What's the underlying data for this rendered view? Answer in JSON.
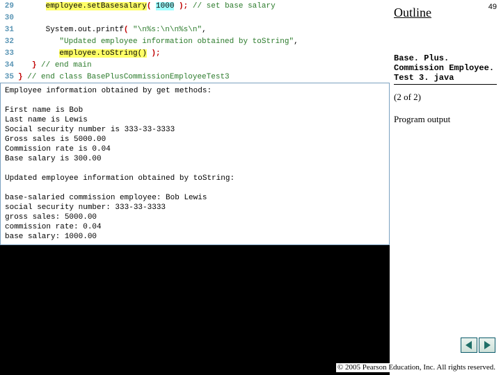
{
  "page_number": "49",
  "outline": {
    "title": "Outline",
    "file_label": "Base. Plus. Commission Employee. Test 3. java",
    "part": "(2 of 2)",
    "section": "Program output"
  },
  "code": {
    "lines": [
      {
        "n": "29",
        "indent": "      ",
        "segments": [
          {
            "t": "employee.set",
            "cls": "hl-yellow"
          },
          {
            "t": "Basesalary",
            "cls": "hl-yellow"
          },
          {
            "t": "( ",
            "cls": "paren"
          },
          {
            "t": "1000",
            "cls": "hl-cyan"
          },
          {
            "t": " )",
            "cls": "paren"
          },
          {
            "t": "; ",
            "cls": "semi"
          },
          {
            "t": "// set base salary",
            "cls": "cmt"
          }
        ]
      },
      {
        "n": "30",
        "indent": "",
        "segments": []
      },
      {
        "n": "31",
        "indent": "      ",
        "segments": [
          {
            "t": "System.out.printf",
            "cls": "kw"
          },
          {
            "t": "( ",
            "cls": "paren"
          },
          {
            "t": "\"\\n%s:\\n\\n%s\\n\"",
            "cls": "str"
          },
          {
            "t": ",",
            "cls": "kw"
          }
        ]
      },
      {
        "n": "32",
        "indent": "         ",
        "segments": [
          {
            "t": "\"Updated employee information obtained by toString\"",
            "cls": "str"
          },
          {
            "t": ",",
            "cls": "kw"
          }
        ]
      },
      {
        "n": "33",
        "indent": "         ",
        "segments": [
          {
            "t": "employee.toString()",
            "cls": "hl-yellow"
          },
          {
            "t": " )",
            "cls": "paren"
          },
          {
            "t": ";",
            "cls": "semi"
          }
        ]
      },
      {
        "n": "34",
        "indent": "   ",
        "segments": [
          {
            "t": "} ",
            "cls": "brace"
          },
          {
            "t": "// end main",
            "cls": "cmt"
          }
        ]
      },
      {
        "n": "35",
        "indent": "",
        "segments": [
          {
            "t": "} ",
            "cls": "brace"
          },
          {
            "t": "// end class BasePlusCommissionEmployeeTest3",
            "cls": "cmt"
          }
        ]
      }
    ]
  },
  "output_text": "Employee information obtained by get methods:\n\nFirst name is Bob\nLast name is Lewis\nSocial security number is 333-33-3333\nGross sales is 5000.00\nCommission rate is 0.04\nBase salary is 300.00\n\nUpdated employee information obtained by toString:\n\nbase-salaried commission employee: Bob Lewis\nsocial security number: 333-33-3333\ngross sales: 5000.00\ncommission rate: 0.04\nbase salary: 1000.00",
  "copyright": "© 2005 Pearson Education,\nInc.  All rights reserved.",
  "colors": {
    "arrow_fill": "#1f6f68",
    "arrow_border": "#0a5a6a"
  }
}
